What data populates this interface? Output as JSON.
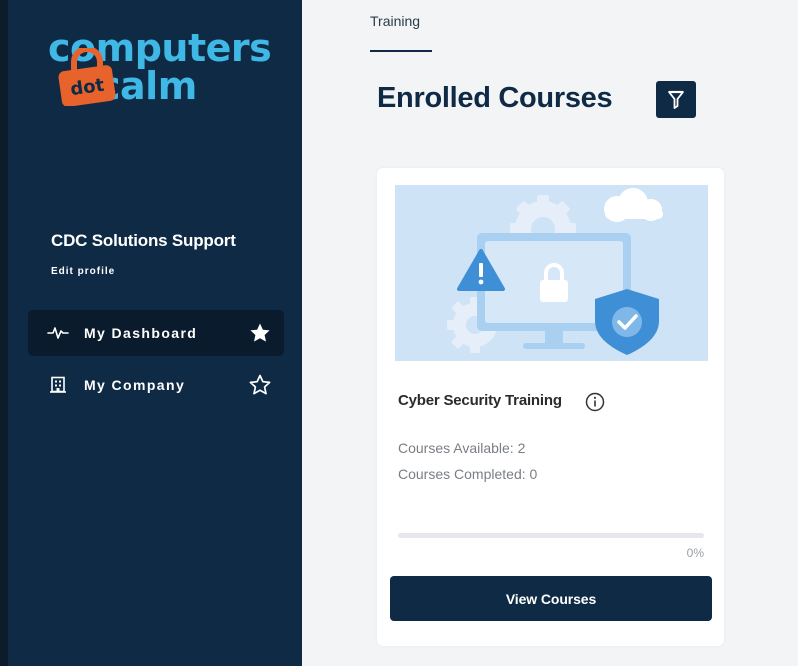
{
  "brand": {
    "logo_line1": "computers",
    "logo_line2": "calm",
    "logo_badge": "dot",
    "logo_color": "#3fb8e6",
    "badge_color": "#e8622c"
  },
  "sidebar": {
    "profile_name": "CDC Solutions Support",
    "edit_profile": "Edit profile",
    "items": [
      {
        "label": "My Dashboard",
        "icon": "activity-icon",
        "favorite": true,
        "active": true
      },
      {
        "label": "My Company",
        "icon": "building-icon",
        "favorite": false,
        "active": false
      }
    ]
  },
  "main": {
    "breadcrumb": "Training",
    "title": "Enrolled Courses",
    "filter_icon": "filter-icon",
    "card": {
      "image": "cyber-security-illustration",
      "title": "Cyber Security Training",
      "courses_available": "Courses Available: 2",
      "courses_completed": "Courses Completed: 0",
      "progress_fraction": 0,
      "progress_label": "0%",
      "button_label": "View Courses"
    }
  },
  "colors": {
    "sidebar_bg": "#0f2a45",
    "accent": "#0f2a45",
    "page_bg": "#f3f4f6"
  }
}
